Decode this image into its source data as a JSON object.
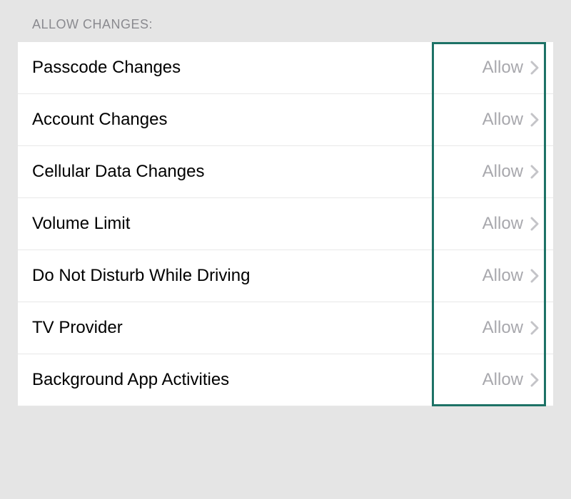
{
  "section": {
    "header": "Allow Changes:",
    "items": [
      {
        "label": "Passcode Changes",
        "value": "Allow"
      },
      {
        "label": "Account Changes",
        "value": "Allow"
      },
      {
        "label": "Cellular Data Changes",
        "value": "Allow"
      },
      {
        "label": "Volume Limit",
        "value": "Allow"
      },
      {
        "label": "Do Not Disturb While Driving",
        "value": "Allow"
      },
      {
        "label": "TV Provider",
        "value": "Allow"
      },
      {
        "label": "Background App Activities",
        "value": "Allow"
      }
    ]
  },
  "colors": {
    "highlight": "#1d7266"
  }
}
